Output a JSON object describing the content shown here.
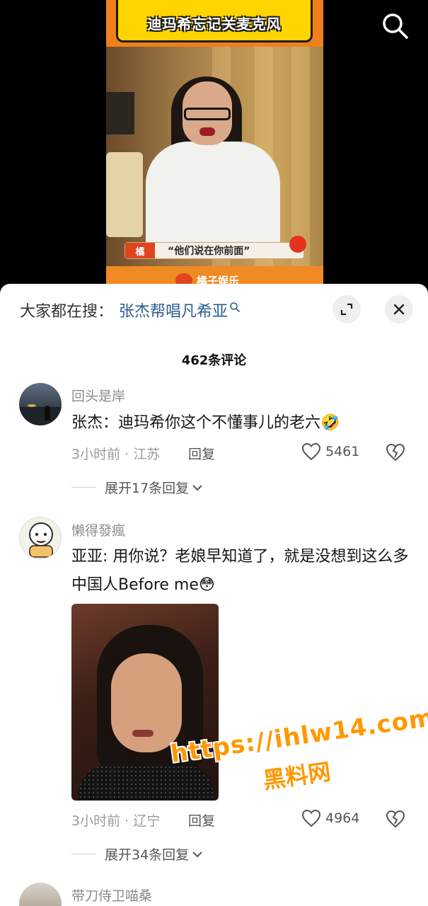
{
  "video": {
    "banner_text": "迪玛希忘记关麦克风",
    "subtitle_tag": "橘",
    "subtitle_text": "“他们说在你前面”",
    "footer_text": "橘子娱乐"
  },
  "top_bar": {
    "search_icon": "search-icon"
  },
  "comments_sheet": {
    "search_hint": {
      "prefix": "大家都在搜：",
      "query": "张杰帮唱凡希亚",
      "icon": "search-icon"
    },
    "expand_icon": "expand-icon",
    "close_icon": "close-icon",
    "comment_count": "462条评论",
    "comments": [
      {
        "username": "回头是岸",
        "text": "张杰：迪玛希你这个不懂事儿的老六🤣",
        "time_location": "3小时前 · 江苏",
        "reply_label": "回复",
        "likes": "5461",
        "expand_label": "展开17条回复"
      },
      {
        "username": "懒得發瘋",
        "text": "亚亚: 用你说？老娘早知道了，就是没想到这么多中国人Before me😳",
        "time_location": "3小时前 · 辽宁",
        "reply_label": "回复",
        "likes": "4964",
        "expand_label": "展开34条回复"
      },
      {
        "username": "带刀侍卫喵桑"
      }
    ]
  },
  "watermark": {
    "url": "https://ihlw14.com",
    "name": "黑料网"
  },
  "colors": {
    "accent_link": "#2c5d8f",
    "banner_orange": "#f07f1c",
    "banner_yellow": "#ffd400",
    "watermark_orange": "#ff9800"
  }
}
